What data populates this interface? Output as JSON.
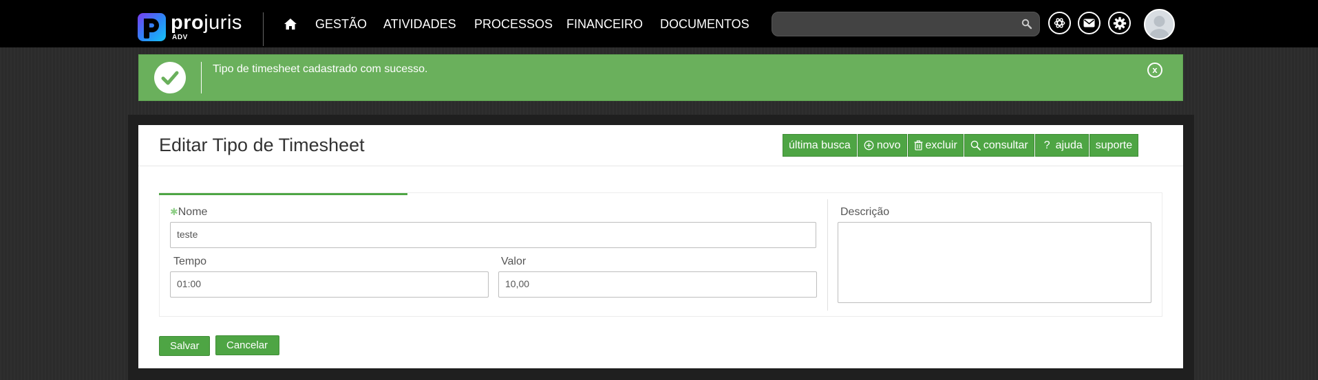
{
  "brand": {
    "name_bold": "pro",
    "name_light": "juris",
    "sub": "ADV"
  },
  "nav": {
    "items": [
      {
        "label": "GESTÃO"
      },
      {
        "label": "ATIVIDADES"
      },
      {
        "label": "PROCESSOS"
      },
      {
        "label": "FINANCEIRO"
      },
      {
        "label": "DOCUMENTOS"
      }
    ],
    "search_value": ""
  },
  "alert": {
    "message": "Tipo de timesheet cadastrado com sucesso.",
    "close_label": "x"
  },
  "page": {
    "title": "Editar Tipo de Timesheet"
  },
  "toolbar": {
    "ultima_busca": "última busca",
    "novo": "novo",
    "excluir": "excluir",
    "consultar": "consultar",
    "ajuda_mark": "?",
    "ajuda": "ajuda",
    "suporte": "suporte"
  },
  "form": {
    "nome_label": "Nome",
    "nome_value": "teste",
    "tempo_label": "Tempo",
    "tempo_value": "01:00",
    "valor_label": "Valor",
    "valor_value": "10,00",
    "descricao_label": "Descrição",
    "descricao_value": ""
  },
  "actions": {
    "salvar": "Salvar",
    "cancelar": "Cancelar"
  },
  "colors": {
    "accent": "#4ea544",
    "alert_bg": "#6ab05c",
    "nav_bg": "#000000"
  }
}
